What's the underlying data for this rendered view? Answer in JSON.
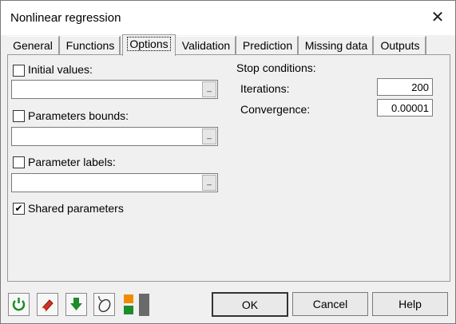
{
  "window": {
    "title": "Nonlinear regression",
    "close_label": "✕"
  },
  "tabs": [
    {
      "label": "General"
    },
    {
      "label": "Functions"
    },
    {
      "label": "Options"
    },
    {
      "label": "Validation"
    },
    {
      "label": "Prediction"
    },
    {
      "label": "Missing data"
    },
    {
      "label": "Outputs"
    }
  ],
  "options": {
    "initial_values": {
      "label": "Initial values:",
      "checked": false,
      "value": ""
    },
    "parameters_bounds": {
      "label": "Parameters bounds:",
      "checked": false,
      "value": ""
    },
    "parameter_labels": {
      "label": "Parameter labels:",
      "checked": false,
      "value": ""
    },
    "shared_parameters": {
      "label": "Shared parameters",
      "checked": true,
      "mark": "✔"
    },
    "picker_glyph": "_"
  },
  "stop_conditions": {
    "heading": "Stop conditions:",
    "iterations": {
      "label": "Iterations:",
      "value": "200"
    },
    "convergence": {
      "label": "Convergence:",
      "value": "0.00001"
    }
  },
  "buttons": {
    "ok": "OK",
    "cancel": "Cancel",
    "help": "Help"
  },
  "toolbar": {
    "icons": [
      "reset-icon",
      "eraser-icon",
      "download-arrow-icon",
      "mouse-icon",
      "layout-toggle-icon"
    ],
    "colors": {
      "green": "#1e8c2a",
      "orange": "#f08c00",
      "red": "#d83020",
      "gray": "#6a6a6a"
    }
  }
}
